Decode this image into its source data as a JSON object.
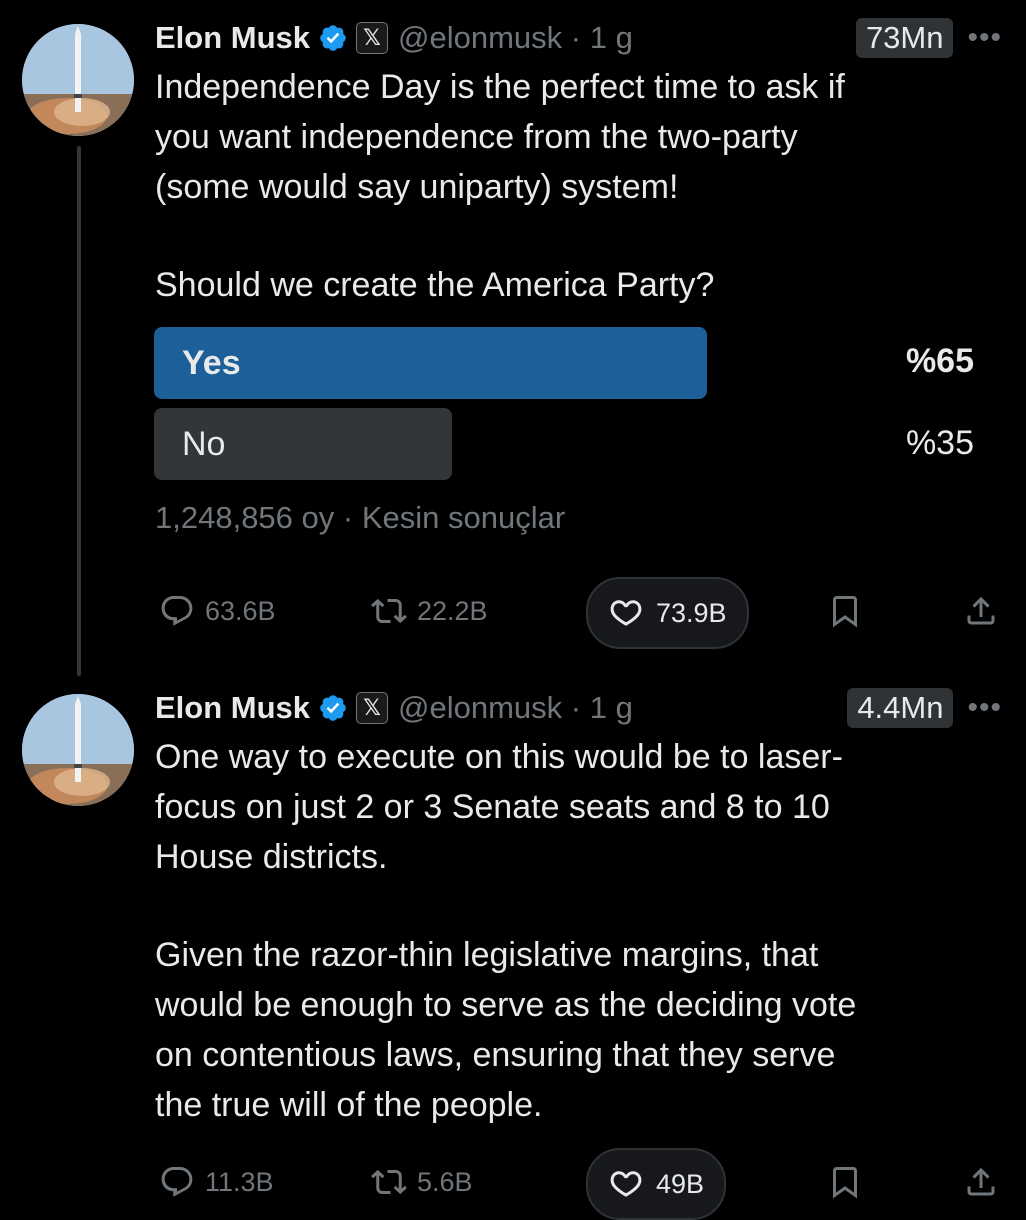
{
  "tweets": [
    {
      "author": {
        "name": "Elon Musk",
        "handle": "@elonmusk",
        "time_sep": " · ",
        "time": "1 g",
        "badge_icon": "verified-badge-icon",
        "affiliation_icon": "x-logo-icon"
      },
      "views": "73Mn",
      "text_lines": [
        "Independence Day is the perfect time to ask if",
        "you want independence from the two-party",
        "(some would say uniparty) system!"
      ],
      "question": "Should we create the America Party?",
      "poll": {
        "options": [
          {
            "label": "Yes",
            "percent": "%65",
            "fraction": 0.65
          },
          {
            "label": "No",
            "percent": "%35",
            "fraction": 0.35
          }
        ],
        "votes": "1,248,856 oy",
        "status": "Kesin sonuçlar"
      },
      "stats": {
        "replies": "63.6B",
        "reposts": "22.2B",
        "likes": "73.9B"
      }
    },
    {
      "author": {
        "name": "Elon Musk",
        "handle": "@elonmusk",
        "time_sep": " · ",
        "time": "1 g",
        "badge_icon": "verified-badge-icon",
        "affiliation_icon": "x-logo-icon"
      },
      "views": "4.4Mn",
      "para1": [
        "One way to execute on this would be to laser-",
        "focus on just 2 or 3 Senate seats and 8 to 10",
        "House districts."
      ],
      "para2": [
        "Given the razor-thin legislative margins, that",
        "would be enough to serve as the deciding vote",
        "on contentious laws, ensuring that they serve",
        "the true will of the people."
      ],
      "stats": {
        "replies": "11.3B",
        "reposts": "5.6B",
        "likes": "49B"
      }
    }
  ],
  "colors": {
    "poll_leading": "#1d5f98",
    "poll_other": "#333639",
    "verified": "#1d9bf0",
    "muted": "#71767b"
  }
}
